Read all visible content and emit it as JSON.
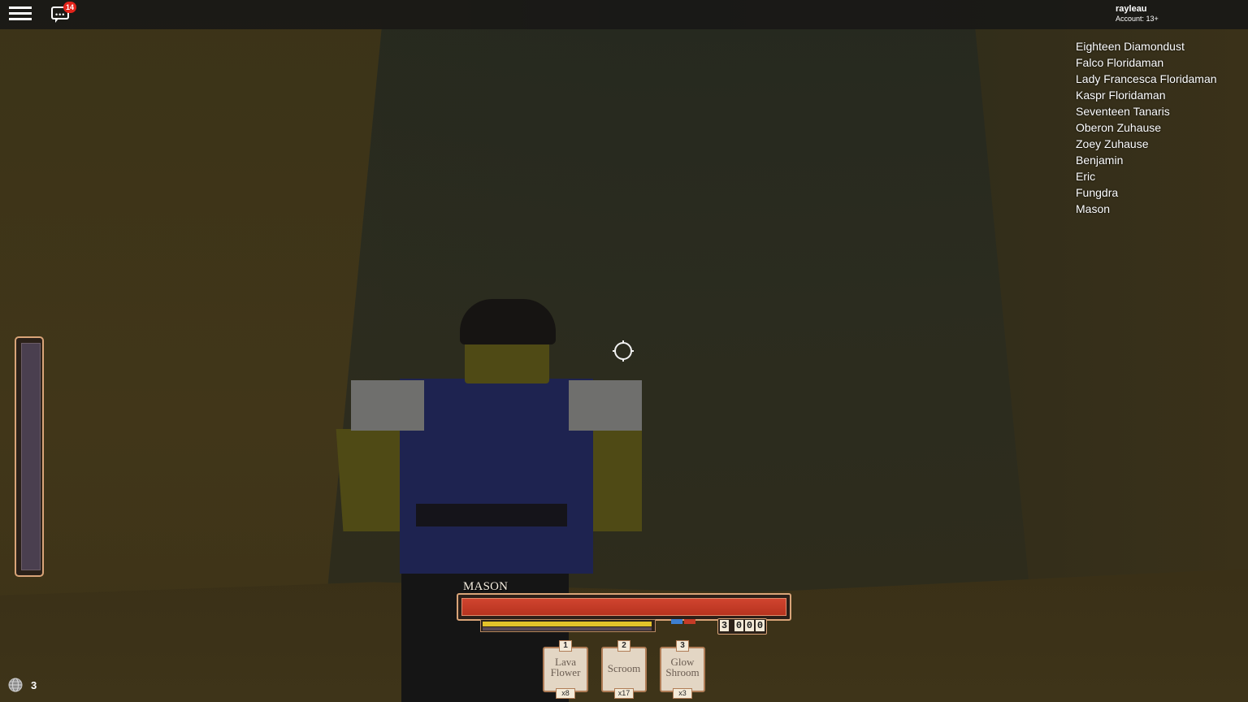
{
  "topbar": {
    "chat_badge": "14",
    "username": "rayleau",
    "account_age": "Account: 13+"
  },
  "players": [
    "Eighteen Diamondust",
    "Falco Floridaman",
    "Lady Francesca Floridaman",
    "Kaspr Floridaman",
    "Seventeen Tanaris",
    "Oberon Zuhause",
    "Zoey Zuhause",
    "Benjamin",
    "Eric",
    "Fungdra",
    "Mason"
  ],
  "hud": {
    "character_name": "MASON",
    "health_fraction": 1.0,
    "stamina_fraction": 0.99,
    "currency_digits": [
      "3",
      "0",
      "0",
      "0"
    ],
    "colors": {
      "health": "#c63b26",
      "stamina": "#e3c22a",
      "frame": "#d9a478",
      "mana_blue": "#3d7fd0",
      "mana_red": "#c63b26"
    }
  },
  "hotbar": [
    {
      "key": "1",
      "line1": "Lava",
      "line2": "Flower",
      "count": "x8"
    },
    {
      "key": "2",
      "line1": "Scroom",
      "line2": "",
      "count": "x17"
    },
    {
      "key": "3",
      "line1": "Glow",
      "line2": "Shroom",
      "count": "x3"
    }
  ],
  "online_count": "3",
  "icons": {
    "menu": "hamburger-menu-icon",
    "chat": "chat-bubble-icon",
    "crosshair": "crosshair-icon",
    "online": "globe-icon"
  }
}
